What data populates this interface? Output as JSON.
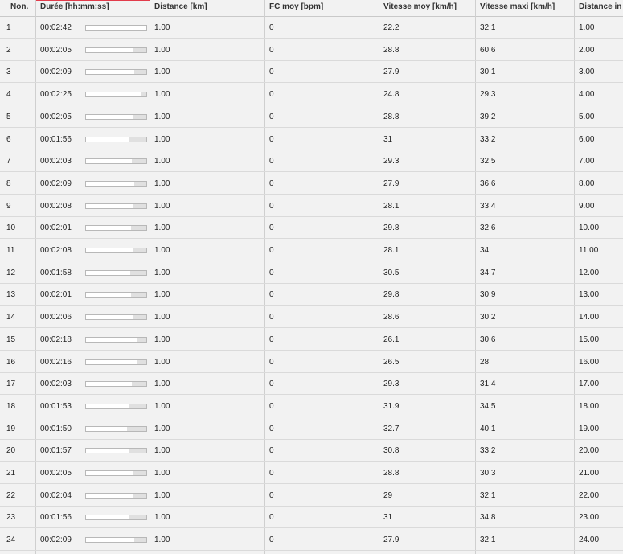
{
  "table": {
    "headers": [
      "Non.",
      "Durée [hh:mm:ss]",
      "Distance [km]",
      "FC moy [bpm]",
      "Vitesse moy [km/h]",
      "Vitesse maxi [km/h]",
      "Distance in"
    ],
    "rows": [
      {
        "no": "1",
        "duree": "00:02:42",
        "bar": 1.0,
        "distance": "1.00",
        "fc": "0",
        "vmoy": "22.2",
        "vmax": "32.1",
        "dist_in": "1.00"
      },
      {
        "no": "2",
        "duree": "00:02:05",
        "bar": 0.77,
        "distance": "1.00",
        "fc": "0",
        "vmoy": "28.8",
        "vmax": "60.6",
        "dist_in": "2.00"
      },
      {
        "no": "3",
        "duree": "00:02:09",
        "bar": 0.8,
        "distance": "1.00",
        "fc": "0",
        "vmoy": "27.9",
        "vmax": "30.1",
        "dist_in": "3.00"
      },
      {
        "no": "4",
        "duree": "00:02:25",
        "bar": 0.9,
        "distance": "1.00",
        "fc": "0",
        "vmoy": "24.8",
        "vmax": "29.3",
        "dist_in": "4.00"
      },
      {
        "no": "5",
        "duree": "00:02:05",
        "bar": 0.77,
        "distance": "1.00",
        "fc": "0",
        "vmoy": "28.8",
        "vmax": "39.2",
        "dist_in": "5.00"
      },
      {
        "no": "6",
        "duree": "00:01:56",
        "bar": 0.72,
        "distance": "1.00",
        "fc": "0",
        "vmoy": "31",
        "vmax": "33.2",
        "dist_in": "6.00"
      },
      {
        "no": "7",
        "duree": "00:02:03",
        "bar": 0.76,
        "distance": "1.00",
        "fc": "0",
        "vmoy": "29.3",
        "vmax": "32.5",
        "dist_in": "7.00"
      },
      {
        "no": "8",
        "duree": "00:02:09",
        "bar": 0.8,
        "distance": "1.00",
        "fc": "0",
        "vmoy": "27.9",
        "vmax": "36.6",
        "dist_in": "8.00"
      },
      {
        "no": "9",
        "duree": "00:02:08",
        "bar": 0.79,
        "distance": "1.00",
        "fc": "0",
        "vmoy": "28.1",
        "vmax": "33.4",
        "dist_in": "9.00"
      },
      {
        "no": "10",
        "duree": "00:02:01",
        "bar": 0.75,
        "distance": "1.00",
        "fc": "0",
        "vmoy": "29.8",
        "vmax": "32.6",
        "dist_in": "10.00"
      },
      {
        "no": "11",
        "duree": "00:02:08",
        "bar": 0.79,
        "distance": "1.00",
        "fc": "0",
        "vmoy": "28.1",
        "vmax": "34",
        "dist_in": "11.00"
      },
      {
        "no": "12",
        "duree": "00:01:58",
        "bar": 0.73,
        "distance": "1.00",
        "fc": "0",
        "vmoy": "30.5",
        "vmax": "34.7",
        "dist_in": "12.00"
      },
      {
        "no": "13",
        "duree": "00:02:01",
        "bar": 0.75,
        "distance": "1.00",
        "fc": "0",
        "vmoy": "29.8",
        "vmax": "30.9",
        "dist_in": "13.00"
      },
      {
        "no": "14",
        "duree": "00:02:06",
        "bar": 0.78,
        "distance": "1.00",
        "fc": "0",
        "vmoy": "28.6",
        "vmax": "30.2",
        "dist_in": "14.00"
      },
      {
        "no": "15",
        "duree": "00:02:18",
        "bar": 0.85,
        "distance": "1.00",
        "fc": "0",
        "vmoy": "26.1",
        "vmax": "30.6",
        "dist_in": "15.00"
      },
      {
        "no": "16",
        "duree": "00:02:16",
        "bar": 0.84,
        "distance": "1.00",
        "fc": "0",
        "vmoy": "26.5",
        "vmax": "28",
        "dist_in": "16.00"
      },
      {
        "no": "17",
        "duree": "00:02:03",
        "bar": 0.76,
        "distance": "1.00",
        "fc": "0",
        "vmoy": "29.3",
        "vmax": "31.4",
        "dist_in": "17.00"
      },
      {
        "no": "18",
        "duree": "00:01:53",
        "bar": 0.7,
        "distance": "1.00",
        "fc": "0",
        "vmoy": "31.9",
        "vmax": "34.5",
        "dist_in": "18.00"
      },
      {
        "no": "19",
        "duree": "00:01:50",
        "bar": 0.68,
        "distance": "1.00",
        "fc": "0",
        "vmoy": "32.7",
        "vmax": "40.1",
        "dist_in": "19.00"
      },
      {
        "no": "20",
        "duree": "00:01:57",
        "bar": 0.72,
        "distance": "1.00",
        "fc": "0",
        "vmoy": "30.8",
        "vmax": "33.2",
        "dist_in": "20.00"
      },
      {
        "no": "21",
        "duree": "00:02:05",
        "bar": 0.77,
        "distance": "1.00",
        "fc": "0",
        "vmoy": "28.8",
        "vmax": "30.3",
        "dist_in": "21.00"
      },
      {
        "no": "22",
        "duree": "00:02:04",
        "bar": 0.77,
        "distance": "1.00",
        "fc": "0",
        "vmoy": "29",
        "vmax": "32.1",
        "dist_in": "22.00"
      },
      {
        "no": "23",
        "duree": "00:01:56",
        "bar": 0.72,
        "distance": "1.00",
        "fc": "0",
        "vmoy": "31",
        "vmax": "34.8",
        "dist_in": "23.00"
      },
      {
        "no": "24",
        "duree": "00:02:09",
        "bar": 0.8,
        "distance": "1.00",
        "fc": "0",
        "vmoy": "27.9",
        "vmax": "32.1",
        "dist_in": "24.00"
      }
    ]
  },
  "colors": {
    "accent": "#e23b4b",
    "background": "#f2f2f2",
    "bar_fill": "#ffffff",
    "bar_track": "#e0e0e0"
  }
}
